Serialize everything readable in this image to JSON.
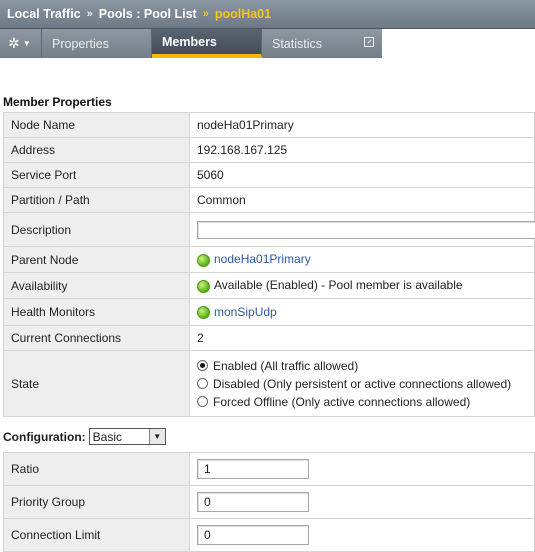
{
  "breadcrumb": {
    "part1": "Local Traffic",
    "part2": "Pools : Pool List",
    "current": "poolHa01"
  },
  "tabs": {
    "gear_icon": "gear-icon",
    "properties": "Properties",
    "members": "Members",
    "statistics": "Statistics"
  },
  "member_properties": {
    "title": "Member Properties",
    "node_name": {
      "label": "Node Name",
      "value": "nodeHa01Primary"
    },
    "address": {
      "label": "Address",
      "value": "192.168.167.125"
    },
    "service_port": {
      "label": "Service Port",
      "value": "5060"
    },
    "partition": {
      "label": "Partition / Path",
      "value": "Common"
    },
    "description": {
      "label": "Description",
      "value": ""
    },
    "parent_node": {
      "label": "Parent Node",
      "value": "nodeHa01Primary"
    },
    "availability": {
      "label": "Availability",
      "value": "Available (Enabled) - Pool member is available"
    },
    "health_monitors": {
      "label": "Health Monitors",
      "value": "monSipUdp"
    },
    "current_connections": {
      "label": "Current Connections",
      "value": "2"
    },
    "state": {
      "label": "State",
      "options": [
        "Enabled (All traffic allowed)",
        "Disabled (Only persistent or active connections allowed)",
        "Forced Offline (Only active connections allowed)"
      ],
      "selected": 0
    }
  },
  "configuration": {
    "label": "Configuration:",
    "mode": "Basic",
    "ratio": {
      "label": "Ratio",
      "value": "1"
    },
    "priority_group": {
      "label": "Priority Group",
      "value": "0"
    },
    "connection_limit": {
      "label": "Connection Limit",
      "value": "0"
    }
  },
  "colors": {
    "status_green": "#59b21a",
    "accent_tab": "#f4b800",
    "current_crumb": "#f4c81b",
    "link": "#2d5aa4"
  }
}
